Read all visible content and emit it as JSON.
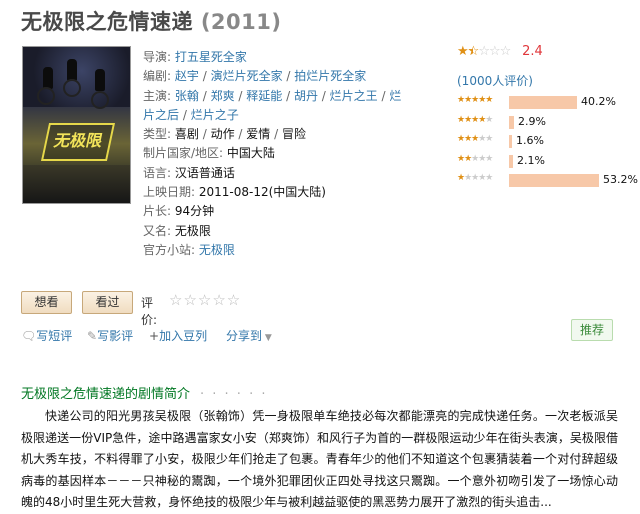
{
  "page": {
    "title": "无极限之危情速递",
    "year": "(2011)"
  },
  "info": {
    "director_label": "导演",
    "director": "打五星死全家",
    "writer_label": "编剧",
    "writers": [
      "赵宇",
      "演烂片死全家",
      "拍烂片死全家"
    ],
    "cast_label": "主演",
    "cast_line1": [
      "张翰",
      "郑爽",
      "释延能",
      "胡丹",
      "烂片之王",
      "烂"
    ],
    "cast_line2": [
      "片之后",
      "烂片之子"
    ],
    "genre_label": "类型",
    "genres": [
      "喜剧",
      "动作",
      "爱情",
      "冒险"
    ],
    "country_label": "制片国家/地区",
    "country": "中国大陆",
    "language_label": "语言",
    "language": "汉语普通话",
    "release_label": "上映日期",
    "release": "2011-08-12(中国大陆)",
    "runtime_label": "片长",
    "runtime": "94分钟",
    "aka_label": "又名",
    "aka": "无极限",
    "site_label": "官方小站",
    "site": "无极限"
  },
  "rating": {
    "stars_filled": 1.5,
    "score": "2.4",
    "votes": "(1000人评价)",
    "distribution": [
      {
        "stars": 5,
        "pct": "40.2%",
        "value": 40.2
      },
      {
        "stars": 4,
        "pct": "2.9%",
        "value": 2.9
      },
      {
        "stars": 3,
        "pct": "1.6%",
        "value": 1.6
      },
      {
        "stars": 2,
        "pct": "2.1%",
        "value": 2.1
      },
      {
        "stars": 1,
        "pct": "53.2%",
        "value": 53.2
      }
    ],
    "star_color": "#e09015",
    "bar_color": "#f7c8a8",
    "score_color": "#e0373b"
  },
  "buttons": {
    "want": "想看",
    "seen": "看过",
    "rate_label": "评价:",
    "rate_stars": "☆☆☆☆☆"
  },
  "actions": {
    "short_review": "写短评",
    "review": "写影评",
    "add_list": "加入豆列",
    "share": "分享到",
    "recommend": "推荐"
  },
  "summary": {
    "title": "无极限之危情速递的剧情简介",
    "dots": "· · · · · ·",
    "text": "快递公司的阳光男孩吴极限（张翰饰）凭一身极限单车绝技必每次都能漂亮的完成快递任务。一次老板派吴极限递送一份VIP急件，途中路遇富家女小安（郑爽饰）和风行子为首的一群极限运动少年在街头表演，吴极限借机大秀车技，不料得罪了小安，极限少年们抢走了包裹。青春年少的他们不知道这个包裹猜装着一个对付辞超级病毒的基因样本－－－只神秘的鬻踟，一个境外犯罪团伙正四处寻找这只鬻踟。一个意外初吻引发了一场惊心动魄的48小时里生死大营救，身怀绝技的极限少年与被利越益驱使的黑恶势力展开了激烈的街头追击..."
  },
  "poster": {
    "logo_text": "无极限"
  }
}
